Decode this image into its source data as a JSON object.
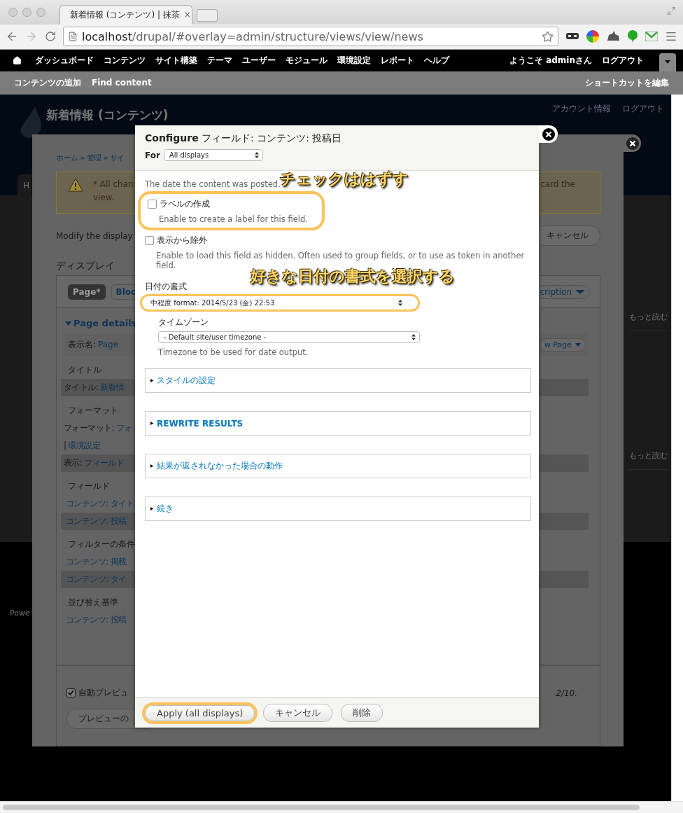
{
  "browser": {
    "tab_title": "新着情報 (コンテンツ) | 抹茶",
    "tab_close": "×",
    "address": {
      "host": "localhost",
      "path": "/drupal/#overlay=admin/structure/views/view/news"
    }
  },
  "toolbar": {
    "menu": [
      "ダッシュボード",
      "コンテンツ",
      "サイト構築",
      "テーマ",
      "ユーザー",
      "モジュール",
      "環境設定",
      "レポート",
      "ヘルプ"
    ],
    "greeting": "ようこそ adminさん",
    "logout": "ログアウト",
    "shortcuts": [
      "コンテンツの追加",
      "Find content"
    ],
    "edit_shortcuts": "ショートカットを編集"
  },
  "site": {
    "title": "新着情報 (コンテンツ)",
    "tab": "H",
    "account_links": [
      "アカウント情報",
      "ログアウト"
    ],
    "sidebar_links": [
      "もっと読む",
      "もっと読む"
    ],
    "footer_text": "Powe"
  },
  "views_overlay": {
    "breadcrumb": "ホーム » 管理 » サイ",
    "warning": {
      "left": [
        "* All chan",
        "view."
      ],
      "right": "card the"
    },
    "intro": "Modify the display",
    "cancel": "キャンセル",
    "displays_heading": "ディスプレイ",
    "display_tabs": [
      {
        "label": "Page*",
        "selected": true
      },
      {
        "label": "Bloc",
        "selected": false
      }
    ],
    "display_menu": "cription",
    "details_heading": "Page details",
    "display_name": {
      "label": "表示名:",
      "value": "Page"
    },
    "view_page": "w Page",
    "sections": [
      {
        "heading": "タイトル",
        "lines": [
          {
            "label": "タイトル:",
            "link": "新着情",
            "shaded": true
          }
        ]
      },
      {
        "heading": "フォーマット",
        "lines": [
          {
            "label": "フォーマット:",
            "link": "フォ",
            "shaded": false
          },
          {
            "label": "|",
            "link": "環境設定",
            "shaded": false
          },
          {
            "label": "表示:",
            "link": "フィールド",
            "shaded": true
          }
        ]
      },
      {
        "heading": "フィールド",
        "lines": [
          {
            "link": "コンテンツ: タイト",
            "shaded": false
          },
          {
            "link": "コンテンツ: 投稿",
            "shaded": true
          }
        ]
      },
      {
        "heading": "フィルターの条件",
        "lines": [
          {
            "link": "コンテンツ: 掲載",
            "shaded": false
          },
          {
            "link": "コンテンツ: タイ",
            "shaded": true
          }
        ]
      },
      {
        "heading": "並び替え基準",
        "lines": [
          {
            "link": "コンテンツ: 投稿",
            "shaded": false
          }
        ]
      }
    ],
    "auto_preview": {
      "label": "自動プレビュ",
      "checked": true
    },
    "note": "2/10.",
    "preview_button": "プレビューの"
  },
  "dialog": {
    "title": "**Configure** フィールド: コンテンツ: 投稿日",
    "for_label": "For",
    "for_value": "All displays",
    "description": "The date the content was posted.",
    "checkboxes": [
      {
        "label": "ラベルの作成",
        "description": "Enable to create a label for this field.",
        "checked": false,
        "highlighted": true
      },
      {
        "label": "表示から除外",
        "description": "Enable to load this field as hidden. Often used to group fields, or to use as token in another field.",
        "checked": false,
        "highlighted": false
      }
    ],
    "date_format": {
      "label": "日付の書式",
      "value": "中程度 format: 2014/5/23 (金) 22:53",
      "highlighted": true
    },
    "timezone": {
      "label": "タイムゾーン",
      "value": "- Default site/user timezone -",
      "description": "Timezone to be used for date output."
    },
    "fieldsets": [
      {
        "title": "スタイルの設定",
        "expanded": false
      },
      {
        "title": "REWRITE RESULTS",
        "expanded": false
      },
      {
        "title": "結果が返されなかった場合の動作",
        "expanded": false
      },
      {
        "title": "続き",
        "expanded": false
      }
    ],
    "buttons": [
      {
        "label": "Apply (all displays)",
        "highlighted": true
      },
      {
        "label": "キャンセル",
        "highlighted": false
      },
      {
        "label": "削除",
        "highlighted": false
      }
    ]
  },
  "annotations": [
    {
      "text": "チェックははずす"
    },
    {
      "text": "好きな日付の書式を選択する"
    }
  ]
}
